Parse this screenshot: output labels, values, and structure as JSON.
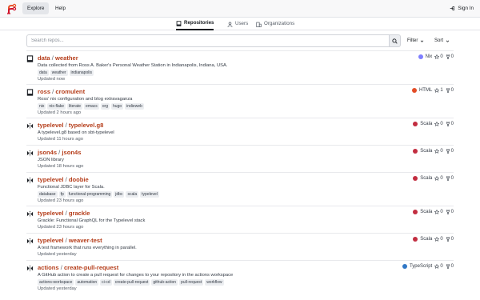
{
  "nav": {
    "explore": "Explore",
    "help": "Help",
    "signin": "Sign In"
  },
  "tabs": [
    {
      "label": "Repositories",
      "icon": "repo-icon"
    },
    {
      "label": "Users",
      "icon": "user-icon"
    },
    {
      "label": "Organizations",
      "icon": "organization-icon"
    }
  ],
  "search": {
    "placeholder": "Search repos...",
    "filter": "Filter",
    "sort": "Sort"
  },
  "colors": {
    "accent": "#b53d1a",
    "logo": "#e8552d"
  },
  "repos": [
    {
      "owner": "data",
      "name": "weather",
      "icon": "repo-icon",
      "desc": "Data collected from Ross A. Baker's Personal Weather Station in Indianapolis, Indiana, USA.",
      "topics": [
        "data",
        "weather",
        "indianapolis"
      ],
      "updated": "Updated now",
      "lang": "Nix",
      "lang_color": "#7e7eff",
      "stars": "0",
      "forks": "0"
    },
    {
      "owner": "ross",
      "name": "cromulent",
      "icon": "repo-icon",
      "desc": "Ross' nix configuration and blog extravaganza",
      "topics": [
        "nix",
        "nix-flake",
        "literate",
        "emacs",
        "org",
        "hugo",
        "indieweb"
      ],
      "updated": "Updated 2 hours ago",
      "lang": "HTML",
      "lang_color": "#e34c26",
      "stars": "1",
      "forks": "0"
    },
    {
      "owner": "typelevel",
      "name": "typelevel.g8",
      "icon": "mirror-icon",
      "desc": "A typelevel.g8 based on sbt-typelevel",
      "topics": [],
      "updated": "Updated 11 hours ago",
      "lang": "Scala",
      "lang_color": "#c22d40",
      "stars": "0",
      "forks": "0"
    },
    {
      "owner": "json4s",
      "name": "json4s",
      "icon": "mirror-icon",
      "desc": "JSON library",
      "topics": [],
      "updated": "Updated 18 hours ago",
      "lang": "Scala",
      "lang_color": "#c22d40",
      "stars": "0",
      "forks": "0"
    },
    {
      "owner": "typelevel",
      "name": "doobie",
      "icon": "mirror-icon",
      "desc": "Functional JDBC layer for Scala.",
      "topics": [
        "database",
        "fp",
        "functional-programming",
        "jdbc",
        "scala",
        "typelevel"
      ],
      "updated": "Updated 23 hours ago",
      "lang": "Scala",
      "lang_color": "#c22d40",
      "stars": "0",
      "forks": "0"
    },
    {
      "owner": "typelevel",
      "name": "grackle",
      "icon": "mirror-icon",
      "desc": "Grackle: Functional GraphQL for the Typelevel stack",
      "topics": [],
      "updated": "Updated 23 hours ago",
      "lang": "Scala",
      "lang_color": "#c22d40",
      "stars": "0",
      "forks": "0"
    },
    {
      "owner": "typelevel",
      "name": "weaver-test",
      "icon": "mirror-icon",
      "desc": "A test framework that runs everything in parallel.",
      "topics": [],
      "updated": "Updated yesterday",
      "lang": "Scala",
      "lang_color": "#c22d40",
      "stars": "0",
      "forks": "0"
    },
    {
      "owner": "actions",
      "name": "create-pull-request",
      "icon": "mirror-icon",
      "desc": "A GitHub action to create a pull request for changes to your repository in the actions workspace",
      "topics": [
        "actions-workspace",
        "automation",
        "ci-cd",
        "create-pull-request",
        "github-action",
        "pull-request",
        "workflow"
      ],
      "updated": "Updated yesterday",
      "lang": "TypeScript",
      "lang_color": "#3178c6",
      "stars": "0",
      "forks": "0"
    }
  ]
}
